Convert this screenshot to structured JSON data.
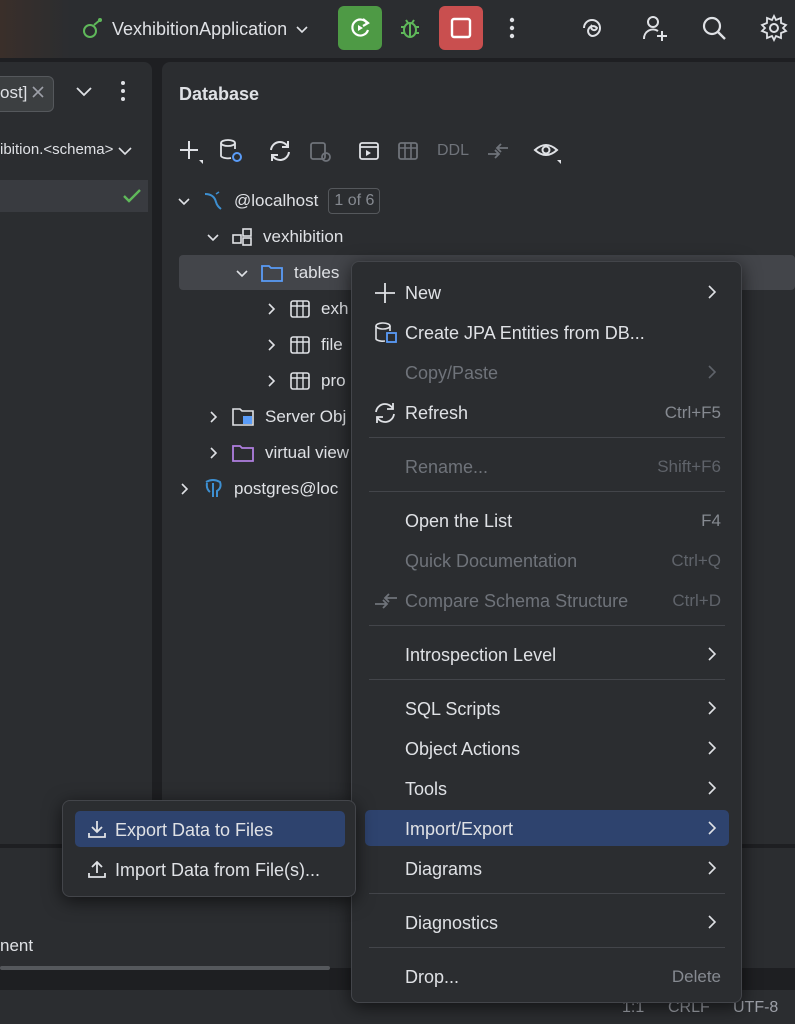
{
  "toolbar": {
    "run_config": "VexhibitionApplication",
    "icons": [
      "run-config-icon",
      "chevron-down-icon",
      "rerun-icon",
      "debug-icon",
      "stop-icon",
      "more-icon",
      "ai-assistant-icon",
      "add-user-icon",
      "search-icon",
      "settings-icon"
    ],
    "colors": {
      "rerun": "#4e9a45",
      "stop": "#c94f4f"
    }
  },
  "left_panel": {
    "tab_label": "ost]",
    "schema_selector": "ibition.<schema>",
    "bottom_text": "nent"
  },
  "database": {
    "title": "Database",
    "toolbar_ddl": "DDL",
    "tree": {
      "host": "@localhost",
      "host_badge": "1 of 6",
      "schema": "vexhibition",
      "tables": "tables",
      "table1": "exh",
      "table2": "file",
      "table3": "pro",
      "server_objects": "Server Obj",
      "virtual_views": "virtual view",
      "postgres": "postgres@loc"
    }
  },
  "context_menu": {
    "new": "New",
    "create_jpa": "Create JPA Entities from DB...",
    "copy_paste": "Copy/Paste",
    "refresh": "Refresh",
    "refresh_sc": "Ctrl+F5",
    "rename": "Rename...",
    "rename_sc": "Shift+F6",
    "open_list": "Open the List",
    "open_list_sc": "F4",
    "quick_doc": "Quick Documentation",
    "quick_doc_sc": "Ctrl+Q",
    "compare": "Compare Schema Structure",
    "compare_sc": "Ctrl+D",
    "introspection": "Introspection Level",
    "sql_scripts": "SQL Scripts",
    "object_actions": "Object Actions",
    "tools": "Tools",
    "import_export": "Import/Export",
    "diagrams": "Diagrams",
    "diagnostics": "Diagnostics",
    "drop": "Drop...",
    "drop_sc": "Delete"
  },
  "submenu": {
    "export": "Export Data to Files",
    "import": "Import Data from File(s)..."
  },
  "status_bar": {
    "position": "1:1",
    "line_ending": "CRLF",
    "encoding": "UTF-8"
  }
}
